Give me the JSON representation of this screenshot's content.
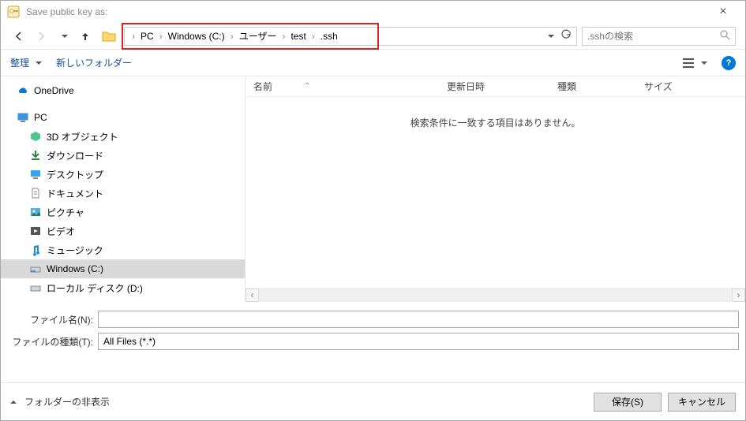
{
  "titlebar": {
    "title": "Save public key as:"
  },
  "nav": {
    "breadcrumbs": [
      "PC",
      "Windows (C:)",
      "ユーザー",
      "test",
      ".ssh"
    ],
    "search_placeholder": ".sshの検索"
  },
  "toolbar": {
    "organize": "整理",
    "new_folder": "新しいフォルダー"
  },
  "sidebar": {
    "items": [
      {
        "label": "OneDrive",
        "icon": "cloud",
        "indent": 0
      },
      {
        "label": "PC",
        "icon": "pc",
        "indent": 0
      },
      {
        "label": "3D オブジェクト",
        "icon": "3d",
        "indent": 1
      },
      {
        "label": "ダウンロード",
        "icon": "download",
        "indent": 1
      },
      {
        "label": "デスクトップ",
        "icon": "desktop",
        "indent": 1
      },
      {
        "label": "ドキュメント",
        "icon": "document",
        "indent": 1
      },
      {
        "label": "ピクチャ",
        "icon": "pictures",
        "indent": 1
      },
      {
        "label": "ビデオ",
        "icon": "video",
        "indent": 1
      },
      {
        "label": "ミュージック",
        "icon": "music",
        "indent": 1
      },
      {
        "label": "Windows (C:)",
        "icon": "drive",
        "indent": 1,
        "selected": true
      },
      {
        "label": "ローカル ディスク (D:)",
        "icon": "drive",
        "indent": 1
      }
    ]
  },
  "columns": {
    "name": "名前",
    "date": "更新日時",
    "type": "種類",
    "size": "サイズ"
  },
  "content": {
    "empty_message": "検索条件に一致する項目はありません。"
  },
  "form": {
    "filename_label": "ファイル名(N):",
    "filetype_label": "ファイルの種類(T):",
    "filename_value": "",
    "filetype_value": "All Files (*.*)"
  },
  "footer": {
    "hide_folders": "フォルダーの非表示",
    "save": "保存(S)",
    "cancel": "キャンセル"
  }
}
